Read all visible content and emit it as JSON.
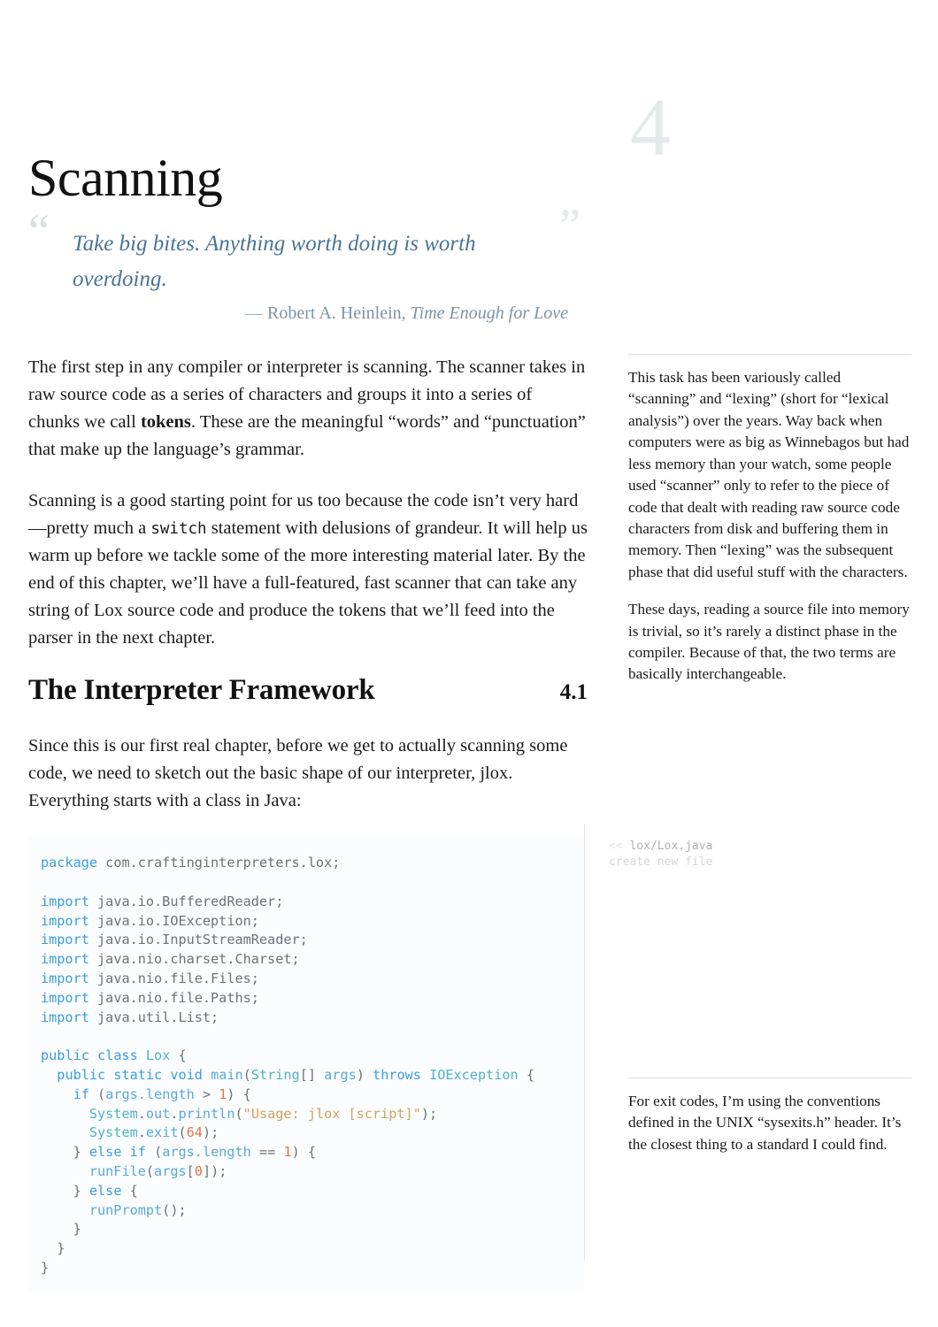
{
  "chapter": {
    "number": "4",
    "title": "Scanning"
  },
  "epigraph": {
    "open_quote": "“",
    "close_quote": "”",
    "text": "Take big bites. Anything worth doing is worth overdoing.",
    "attribution_dash": "—",
    "attribution_author": "Robert A. Heinlein,",
    "attribution_work": "Time Enough for Love"
  },
  "main": {
    "paragraph_1_a": "The first step in any compiler or interpreter is scanning. The scanner takes in raw source code as a series of characters and groups it into a series of chunks we call ",
    "paragraph_1_bold": "tokens",
    "paragraph_1_b": ". These are the meaningful “words” and “punctuation” that make up the language’s grammar.",
    "paragraph_2_a": "Scanning is a good starting point for us too because the code isn’t very hard—pretty much a ",
    "paragraph_2_code": "switch",
    "paragraph_2_b": " statement with delusions of grandeur. It will help us warm up before we tackle some of the more interesting material later. By the end of this chapter, we’ll have a full-featured, fast scanner that can take any string of Lox source code and produce the tokens that we’ll feed into the parser in the next chapter."
  },
  "section": {
    "title": "The Interpreter Framework",
    "number": "4.1",
    "intro": "Since this is our first real chapter, before we get to actually scanning some code, we need to sketch out the basic shape of our interpreter, jlox. Everything starts with a class in Java:"
  },
  "code": {
    "language": "java",
    "lines": [
      "package com.craftinginterpreters.lox;",
      "",
      "import java.io.BufferedReader;",
      "import java.io.IOException;",
      "import java.io.InputStreamReader;",
      "import java.nio.charset.Charset;",
      "import java.nio.file.Files;",
      "import java.nio.file.Paths;",
      "import java.util.List;",
      "",
      "public class Lox {",
      "  public static void main(String[] args) throws IOException {",
      "    if (args.length > 1) {",
      "      System.out.println(\"Usage: jlox [script]\");",
      "      System.exit(64);",
      "    } else if (args.length == 1) {",
      "      runFile(args[0]);",
      "    } else {",
      "      runPrompt();",
      "    }",
      "  }",
      "}"
    ]
  },
  "code_annotation": {
    "marker": "<<",
    "file": "lox/Lox.java",
    "action": "create new file"
  },
  "asides": [
    {
      "id": "aside-scanning",
      "paragraphs": [
        "This task has been variously called “scanning” and “lexing” (short for “lexical analysis”) over the years. Way back when computers were as big as Winnebagos but had less memory than your watch, some people used “scanner” only to refer to the piece of code that dealt with reading raw source code characters from disk and buffering them in memory. Then “lexing” was the subsequent phase that did useful stuff with the characters.",
        "These days, reading a source file into memory is trivial, so it’s rarely a distinct phase in the compiler. Because of that, the two terms are basically interchangeable."
      ]
    },
    {
      "id": "aside-exitcodes",
      "paragraphs": [
        "For exit codes, I’m using the conventions defined in the UNIX “sysexits.h” header. It’s the closest thing to a standard I could find."
      ]
    }
  ],
  "colors": {
    "chapter_number": "#e3eaea",
    "epigraph_text": "#4a7496",
    "epigraph_attribution": "#7d93a6",
    "code_keyword": "#3b9ee0",
    "code_type": "#4fb3c4",
    "code_identifier": "#6b7378",
    "code_string": "#cba361",
    "code_number": "#e4764a",
    "divider": "#e6e6e6"
  }
}
